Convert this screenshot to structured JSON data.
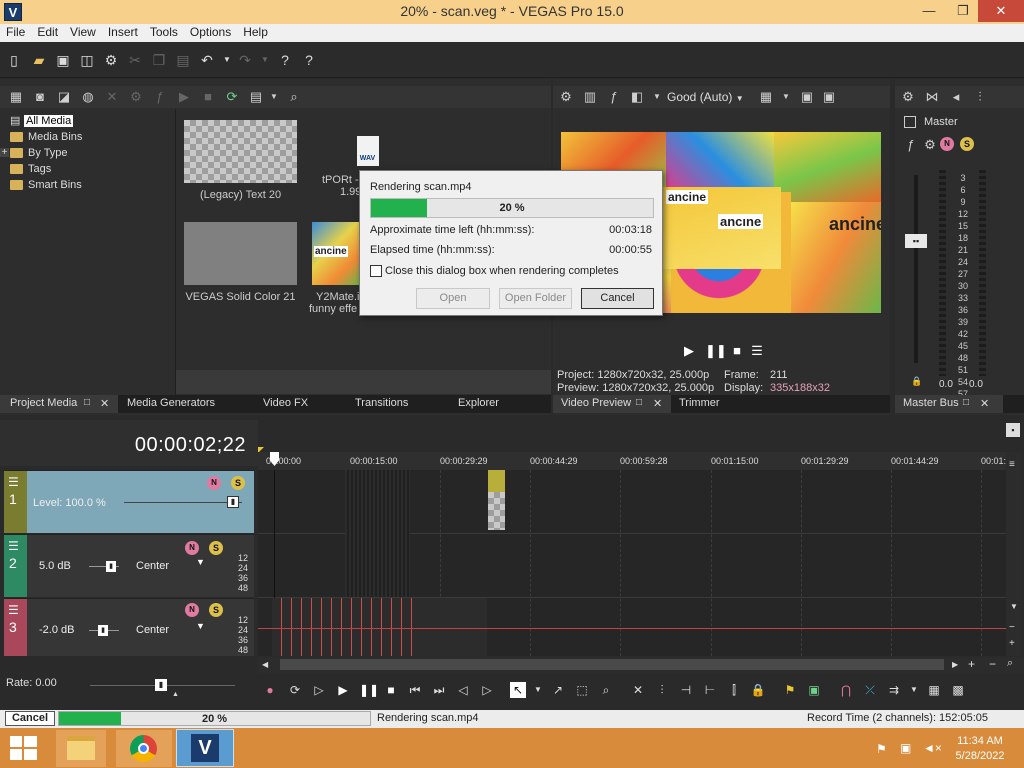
{
  "app": {
    "title": "20% - scan.veg * - VEGAS Pro 15.0",
    "logo_letter": "V",
    "window_buttons": {
      "minimize": "—",
      "maximize": "❐",
      "close": "✕"
    }
  },
  "menu": [
    "File",
    "Edit",
    "View",
    "Insert",
    "Tools",
    "Options",
    "Help"
  ],
  "media": {
    "tree": [
      "All Media",
      "Media Bins",
      "By Type",
      "Tags",
      "Smart Bins"
    ],
    "expander": "+",
    "items": [
      {
        "label": "(Legacy) Text 20",
        "kind": "checker"
      },
      {
        "label": "tPORt -",
        "sub": "1.99",
        "kind": "wav",
        "icon_text": "WAV"
      },
      {
        "label": "VEGAS Solid Color 21",
        "kind": "solid"
      },
      {
        "label": "Y2Mate.i",
        "sub": "funny effe",
        "kind": "video",
        "overlay": "ancine"
      }
    ]
  },
  "tabs_left": [
    "Project Media",
    "Media Generators",
    "Video FX",
    "Transitions",
    "Explorer"
  ],
  "tabs_preview": [
    "Video Preview",
    "Trimmer"
  ],
  "tabs_master": [
    "Master Bus"
  ],
  "preview": {
    "quality": "Good (Auto)",
    "overlay_texts": [
      "ancine",
      "ancıne",
      "ancine"
    ],
    "project_line": "Project:  1280x720x32, 25.000p",
    "preview_line": "Preview:  1280x720x32, 25.000p",
    "frame_label": "Frame:",
    "frame_value": "211",
    "display_label": "Display:",
    "display_value": "335x188x32"
  },
  "master": {
    "label": "Master",
    "scale": [
      "3",
      "6",
      "9",
      "12",
      "15",
      "18",
      "21",
      "24",
      "27",
      "30",
      "33",
      "36",
      "39",
      "42",
      "45",
      "48",
      "51",
      "54",
      "57"
    ],
    "left_value": "0.0",
    "right_value": "0.0"
  },
  "render_dialog": {
    "title": "Rendering scan.mp4",
    "progress_text": "20 %",
    "progress": 0.2,
    "time_left_label": "Approximate time left (hh:mm:ss):",
    "time_left_value": "00:03:18",
    "elapsed_label": "Elapsed time (hh:mm:ss):",
    "elapsed_value": "00:00:55",
    "close_checkbox_label": "Close this dialog box when rendering completes",
    "close_checkbox_checked": false,
    "open_button": "Open",
    "open_folder_button": "Open Folder",
    "cancel_button": "Cancel"
  },
  "timeline": {
    "timecode": "00:00:02;22",
    "ruler": [
      "00:00:00",
      "00:00:15:00",
      "00:00:29:29",
      "00:00:44:29",
      "00:00:59:28",
      "00:01:15:00",
      "00:01:29:29",
      "00:01:44:29",
      "00:01:5"
    ],
    "tracks": [
      {
        "number": "1",
        "kind": "video",
        "level_label": "Level: 100.0 %",
        "color": "#7a7d2f"
      },
      {
        "number": "2",
        "kind": "audio",
        "volume": "5.0 dB",
        "pan": "Center",
        "meter": [
          "12",
          "24",
          "36",
          "48"
        ],
        "color": "#2e8a63"
      },
      {
        "number": "3",
        "kind": "audio",
        "volume": "-2.0 dB",
        "pan": "Center",
        "meter": [
          "12",
          "24",
          "36",
          "48"
        ],
        "color": "#a8485a"
      }
    ],
    "rate_label": "Rate: 0.00"
  },
  "status": {
    "cancel_button": "Cancel",
    "progress_text": "20 %",
    "progress": 0.2,
    "message": "Rendering scan.mp4",
    "record_time": "Record Time (2 channels): 152:05:05"
  },
  "taskbar": {
    "time": "11:34 AM",
    "date": "5/28/2022",
    "apps": [
      "file-explorer-icon",
      "chrome-icon",
      "vegas-icon"
    ]
  },
  "colors": {
    "titlebar": "#f7d18c",
    "accent_green": "#22b14c",
    "taskbar": "#d98b3c",
    "display_value": "#e6a2b8"
  }
}
